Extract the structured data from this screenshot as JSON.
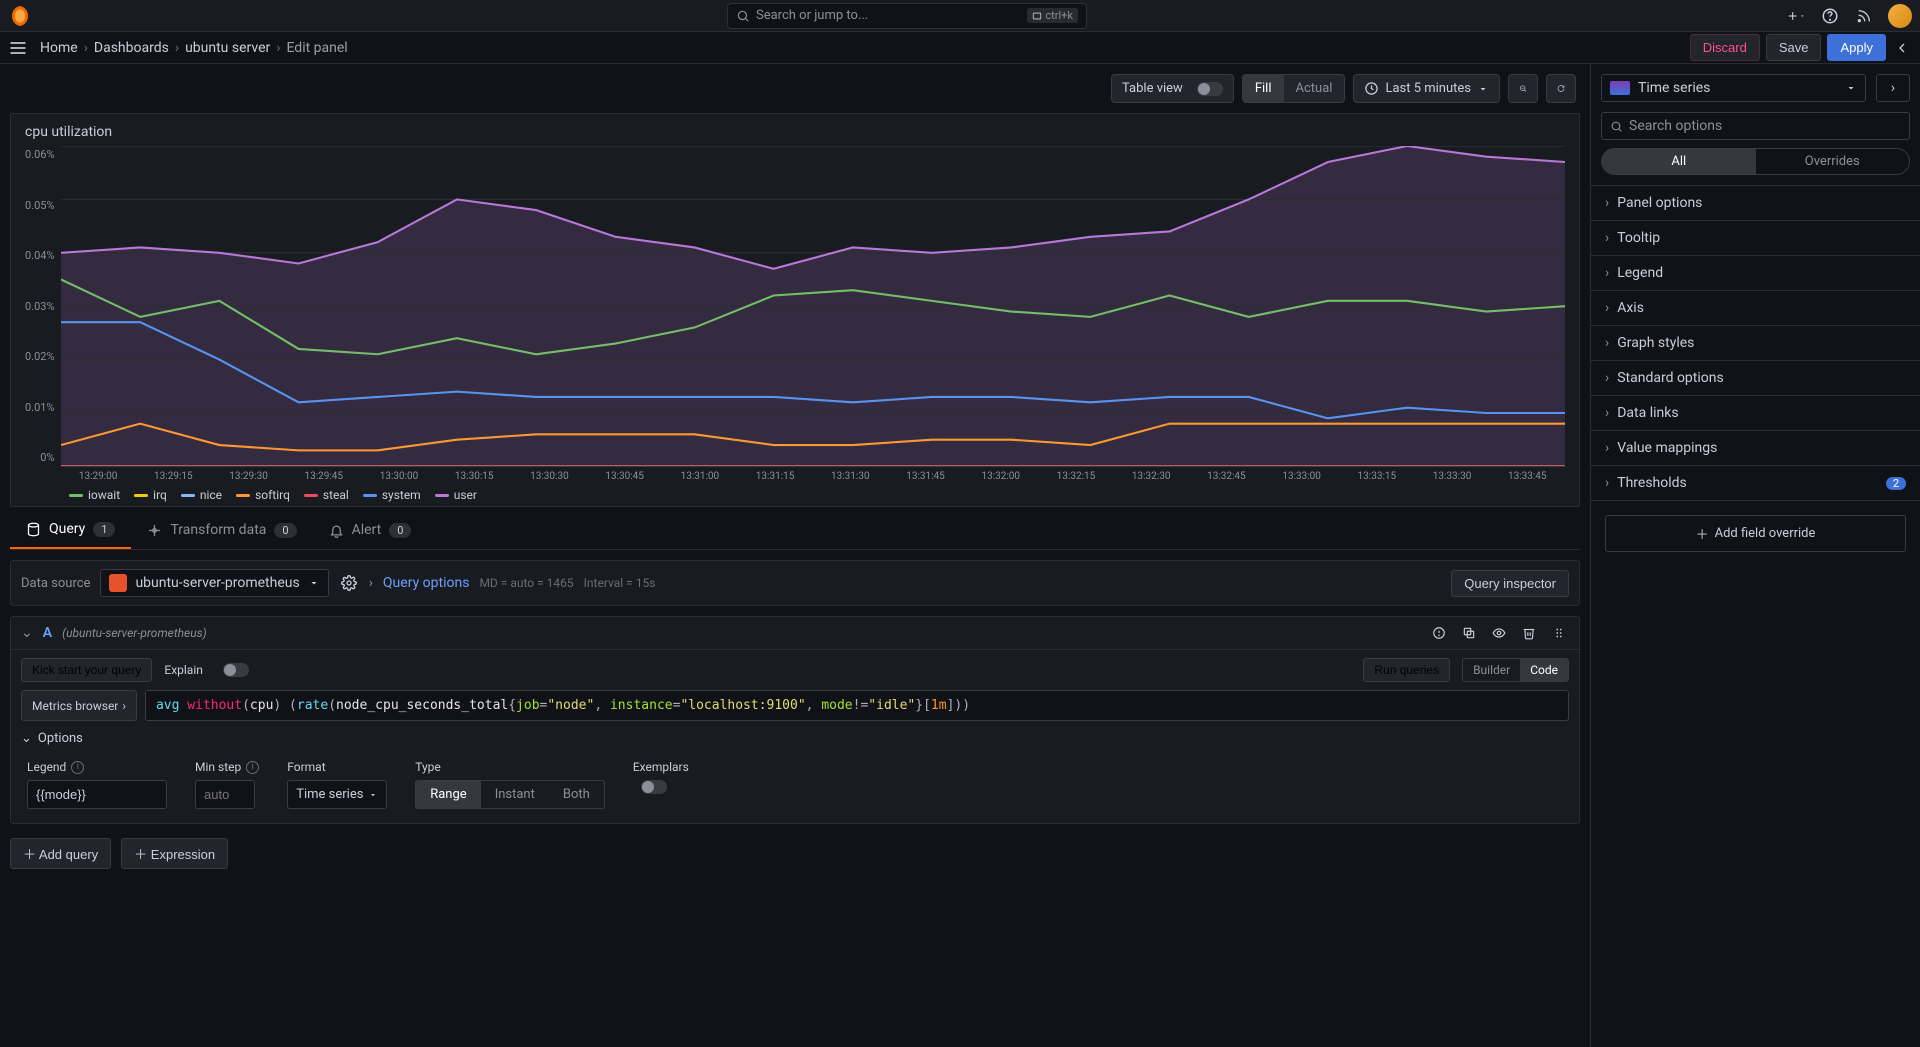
{
  "search": {
    "placeholder": "Search or jump to...",
    "kbd": "ctrl+k"
  },
  "breadcrumb": {
    "home": "Home",
    "dashboards": "Dashboards",
    "dash": "ubuntu server",
    "current": "Edit panel"
  },
  "actions": {
    "discard": "Discard",
    "save": "Save",
    "apply": "Apply"
  },
  "toolbar": {
    "table_view": "Table view",
    "fill": "Fill",
    "actual": "Actual",
    "timerange": "Last 5 minutes"
  },
  "panel": {
    "title": "cpu utilization"
  },
  "chart_data": {
    "type": "area",
    "title": "cpu utilization",
    "ylabel": "",
    "ylim": [
      0,
      0.0006
    ],
    "yticks": [
      "0%",
      "0.01%",
      "0.02%",
      "0.03%",
      "0.04%",
      "0.05%",
      "0.06%"
    ],
    "x": [
      "13:29:00",
      "13:29:15",
      "13:29:30",
      "13:29:45",
      "13:30:00",
      "13:30:15",
      "13:30:30",
      "13:30:45",
      "13:31:00",
      "13:31:15",
      "13:31:30",
      "13:31:45",
      "13:32:00",
      "13:32:15",
      "13:32:30",
      "13:32:45",
      "13:33:00",
      "13:33:15",
      "13:33:30",
      "13:33:45"
    ],
    "series": [
      {
        "name": "iowait",
        "color": "#73bf69",
        "values": [
          0.00035,
          0.00028,
          0.00031,
          0.00022,
          0.00021,
          0.00024,
          0.00021,
          0.00023,
          0.00026,
          0.00032,
          0.00033,
          0.00031,
          0.00029,
          0.00028,
          0.00032,
          0.00028,
          0.00031,
          0.00031,
          0.00029,
          0.0003
        ]
      },
      {
        "name": "irq",
        "color": "#f2cc0c",
        "values": [
          0,
          0,
          0,
          0,
          0,
          0,
          0,
          0,
          0,
          0,
          0,
          0,
          0,
          0,
          0,
          0,
          0,
          0,
          0,
          0
        ]
      },
      {
        "name": "nice",
        "color": "#8ab8ff",
        "values": [
          0,
          0,
          0,
          0,
          0,
          0,
          0,
          0,
          0,
          0,
          0,
          0,
          0,
          0,
          0,
          0,
          0,
          0,
          0,
          0
        ]
      },
      {
        "name": "softirq",
        "color": "#ff9830",
        "values": [
          4e-05,
          8e-05,
          4e-05,
          3e-05,
          3e-05,
          5e-05,
          6e-05,
          6e-05,
          6e-05,
          4e-05,
          4e-05,
          5e-05,
          5e-05,
          4e-05,
          8e-05,
          8e-05,
          8e-05,
          8e-05,
          8e-05,
          8e-05
        ]
      },
      {
        "name": "steal",
        "color": "#f2495c",
        "values": [
          0,
          0,
          0,
          0,
          0,
          0,
          0,
          0,
          0,
          0,
          0,
          0,
          0,
          0,
          0,
          0,
          0,
          0,
          0,
          0
        ]
      },
      {
        "name": "system",
        "color": "#5794f2",
        "values": [
          0.00027,
          0.00027,
          0.0002,
          0.00012,
          0.00013,
          0.00014,
          0.00013,
          0.00013,
          0.00013,
          0.00013,
          0.00012,
          0.00013,
          0.00013,
          0.00012,
          0.00013,
          0.00013,
          9e-05,
          0.00011,
          0.0001,
          0.0001
        ]
      },
      {
        "name": "user",
        "color": "#b877d9",
        "values": [
          0.0004,
          0.00041,
          0.0004,
          0.00038,
          0.00042,
          0.0005,
          0.00048,
          0.00043,
          0.00041,
          0.00037,
          0.00041,
          0.0004,
          0.00041,
          0.00043,
          0.00044,
          0.0005,
          0.00057,
          0.0006,
          0.00058,
          0.00057
        ]
      }
    ]
  },
  "tabs": {
    "query": "Query",
    "query_n": "1",
    "transform": "Transform data",
    "transform_n": "0",
    "alert": "Alert",
    "alert_n": "0"
  },
  "ds": {
    "label": "Data source",
    "name": "ubuntu-server-prometheus",
    "query_options": "Query options",
    "md": "MD = auto = 1465",
    "interval": "Interval = 15s",
    "inspector": "Query inspector"
  },
  "query": {
    "id": "A",
    "src": "(ubuntu-server-prometheus)",
    "kick": "Kick start your query",
    "explain": "Explain",
    "run": "Run queries",
    "builder": "Builder",
    "code": "Code",
    "metrics_browser": "Metrics browser",
    "expr_tokens": [
      {
        "t": "fn",
        "v": "avg "
      },
      {
        "t": "kw",
        "v": "without"
      },
      {
        "t": "p",
        "v": "("
      },
      {
        "t": "id",
        "v": "cpu"
      },
      {
        "t": "p",
        "v": ") ("
      },
      {
        "t": "fn",
        "v": "rate"
      },
      {
        "t": "p",
        "v": "("
      },
      {
        "t": "id",
        "v": "node_cpu_seconds_total"
      },
      {
        "t": "p",
        "v": "{"
      },
      {
        "t": "lbl",
        "v": "job"
      },
      {
        "t": "p",
        "v": "="
      },
      {
        "t": "str",
        "v": "\"node\""
      },
      {
        "t": "p",
        "v": ", "
      },
      {
        "t": "lbl",
        "v": "instance"
      },
      {
        "t": "p",
        "v": "="
      },
      {
        "t": "str",
        "v": "\"localhost:9100\""
      },
      {
        "t": "p",
        "v": ", "
      },
      {
        "t": "lbl",
        "v": "mode"
      },
      {
        "t": "p",
        "v": "!="
      },
      {
        "t": "str",
        "v": "\"idle\""
      },
      {
        "t": "p",
        "v": "}"
      },
      {
        "t": "p",
        "v": "["
      },
      {
        "t": "tm",
        "v": "1m"
      },
      {
        "t": "p",
        "v": "]))"
      }
    ]
  },
  "opts": {
    "options": "Options",
    "legend": "Legend",
    "legend_val": "{{mode}}",
    "minstep": "Min step",
    "minstep_ph": "auto",
    "format": "Format",
    "format_val": "Time series",
    "type": "Type",
    "range": "Range",
    "instant": "Instant",
    "both": "Both",
    "exemplars": "Exemplars"
  },
  "bottom": {
    "add_query": "Add query",
    "expression": "Expression"
  },
  "right": {
    "viz": "Time series",
    "search_ph": "Search options",
    "all": "All",
    "overrides": "Overrides",
    "sections": [
      "Panel options",
      "Tooltip",
      "Legend",
      "Axis",
      "Graph styles",
      "Standard options",
      "Data links",
      "Value mappings",
      "Thresholds"
    ],
    "thresholds_n": "2",
    "add_override": "Add field override"
  }
}
